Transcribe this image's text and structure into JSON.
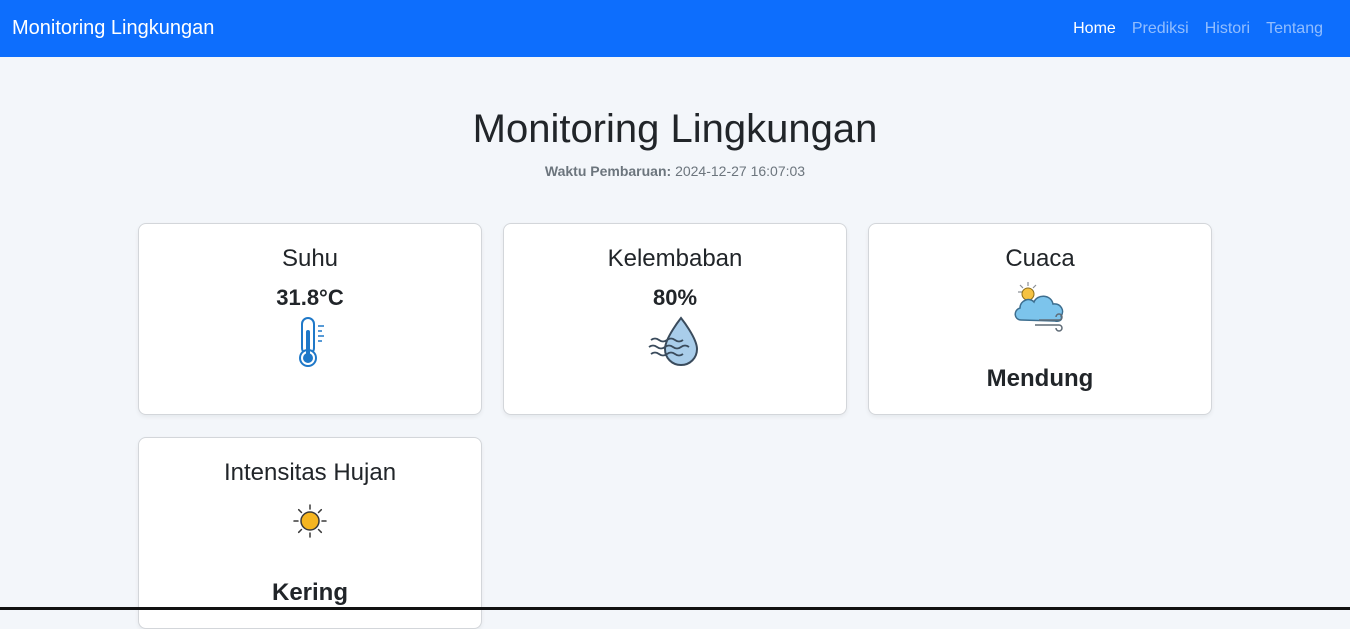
{
  "navbar": {
    "brand": "Monitoring Lingkungan",
    "links": [
      {
        "label": "Home",
        "active": true
      },
      {
        "label": "Prediksi",
        "active": false
      },
      {
        "label": "Histori",
        "active": false
      },
      {
        "label": "Tentang",
        "active": false
      }
    ]
  },
  "header": {
    "title": "Monitoring Lingkungan",
    "update_label": "Waktu Pembaruan:",
    "update_time": "2024-12-27 16:07:03"
  },
  "cards": {
    "suhu": {
      "title": "Suhu",
      "value": "31.8°C",
      "icon": "thermometer-icon"
    },
    "kelembaban": {
      "title": "Kelembaban",
      "value": "80%",
      "icon": "humidity-icon"
    },
    "cuaca": {
      "title": "Cuaca",
      "status": "Mendung",
      "icon": "cloudy-windy-icon"
    },
    "hujan": {
      "title": "Intensitas Hujan",
      "status": "Kering",
      "icon": "sun-icon"
    }
  },
  "colors": {
    "navbar": "#0d6efd",
    "background": "#f3f6fa",
    "thermometer": "#1f78c8",
    "sun": "#f5b521"
  }
}
